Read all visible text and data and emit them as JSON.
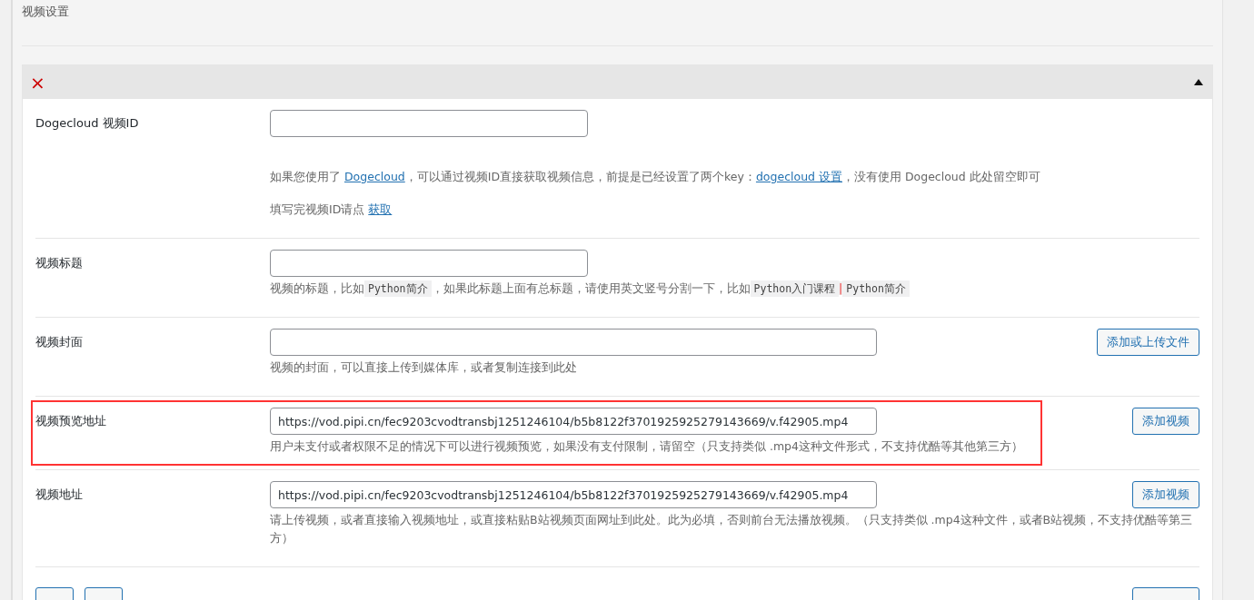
{
  "section_title": "视频设置",
  "group": {
    "close_icon": "×",
    "expanded": true,
    "rows": [
      {
        "label": "Dogecloud 视频ID",
        "value": "",
        "highlighted": false,
        "description": [
          [
            {
              "kind": "text",
              "text": "如果您使用了 "
            },
            {
              "kind": "link",
              "text": "Dogecloud"
            },
            {
              "kind": "text",
              "text": "，可以通过视频ID直接获取视频信息，前提是已经设置了两个key："
            },
            {
              "kind": "link",
              "text": "dogecloud 设置"
            },
            {
              "kind": "text",
              "text": "，没有使用 Dogecloud 此处留空即可"
            }
          ],
          [
            {
              "kind": "text",
              "text": "填写完视频ID请点 "
            },
            {
              "kind": "link",
              "text": "获取"
            }
          ]
        ]
      },
      {
        "label": "视频标题",
        "value": "",
        "highlighted": false,
        "description": [
          [
            {
              "kind": "text",
              "text": "视频的标题，比如"
            },
            {
              "kind": "code",
              "text": "Python简介"
            },
            {
              "kind": "text",
              "text": "，如果此标题上面有总标题，请使用英文竖号分割一下，比如"
            },
            {
              "kind": "code",
              "text": "Python入门课程"
            },
            {
              "kind": "mark",
              "text": "|"
            },
            {
              "kind": "code",
              "text": "Python简介"
            }
          ]
        ]
      },
      {
        "label": "视频封面",
        "value": "",
        "highlighted": false,
        "button": "添加或上传文件",
        "description": [
          [
            {
              "kind": "text",
              "text": "视频的封面，可以直接上传到媒体库，或者复制连接到此处"
            }
          ]
        ]
      },
      {
        "label": "视频预览地址",
        "value": "https://vod.pipi.cn/fec9203cvodtransbj1251246104/b5b8122f3701925925279143669/v.f42905.mp4",
        "highlighted": true,
        "button": "添加视频",
        "description": [
          [
            {
              "kind": "text",
              "text": "用户未支付或者权限不足的情况下可以进行视频预览，如果没有支付限制，请留空（只支持类似 .mp4这种文件形式，不支持优酷等其他第三方）"
            }
          ]
        ]
      },
      {
        "label": "视频地址",
        "value": "https://vod.pipi.cn/fec9203cvodtransbj1251246104/b5b8122f3701925925279143669/v.f42905.mp4",
        "highlighted": false,
        "button": "添加视频",
        "description": [
          [
            {
              "kind": "text",
              "text": "请上传视频，或者直接输入视频地址，或直接粘贴B站视频页面网址到此处。此为必填，否则前台无法播放视频。（只支持类似 .mp4这种文件，或者B站视频，不支持优酷等第三方）"
            }
          ]
        ]
      }
    ]
  }
}
